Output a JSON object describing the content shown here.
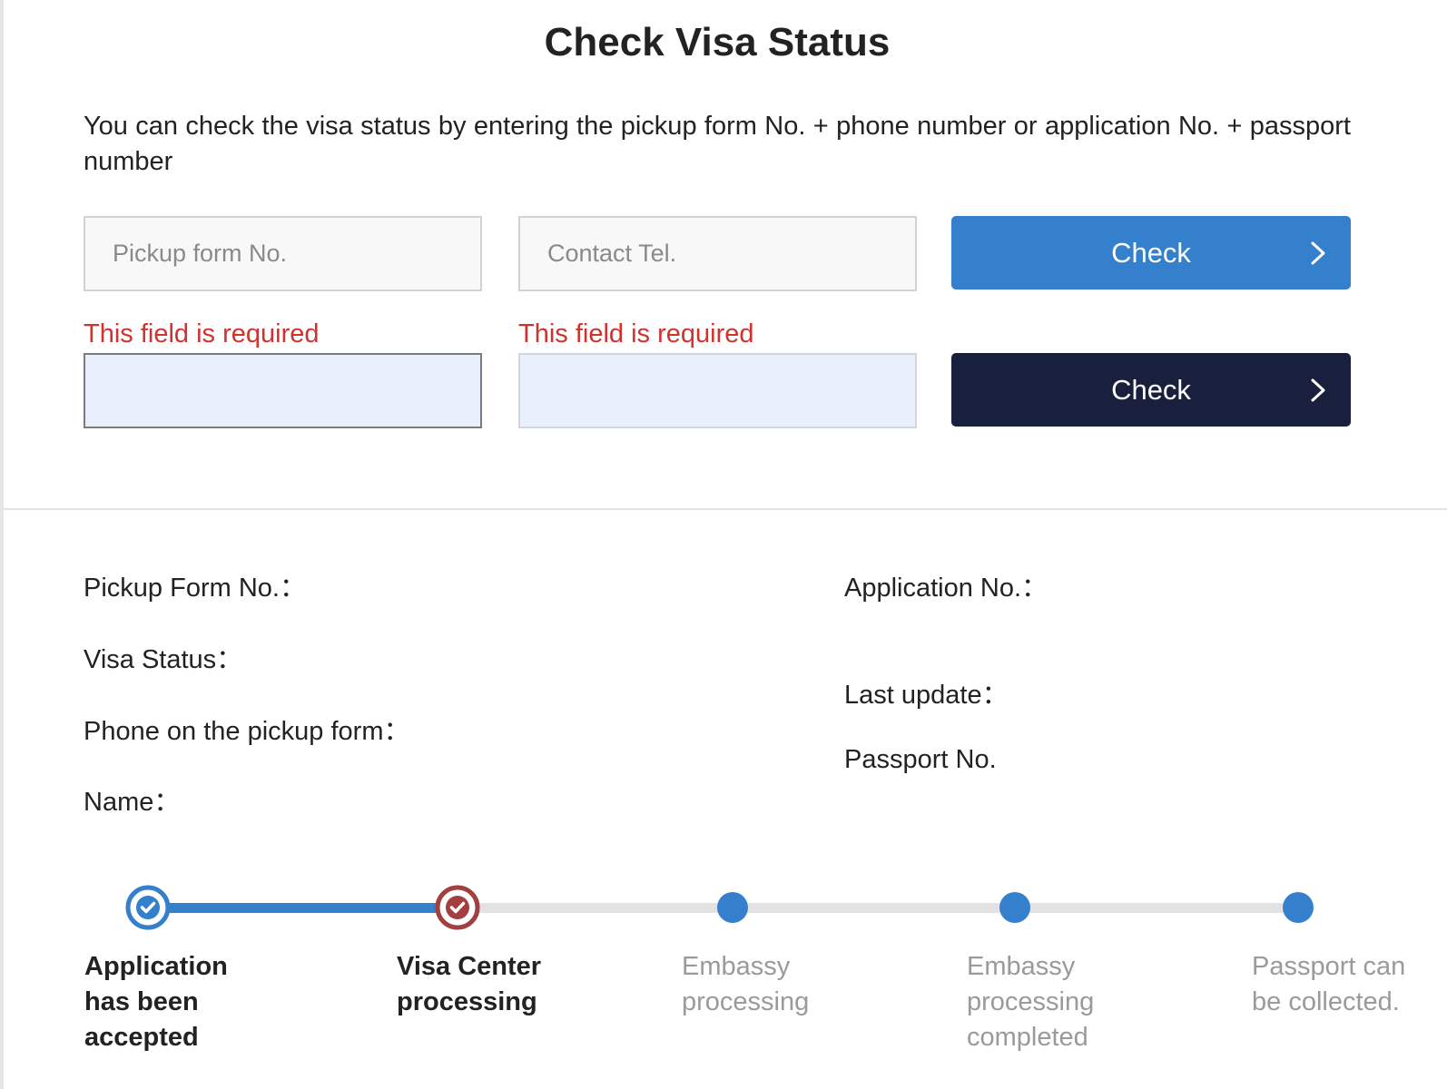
{
  "page": {
    "title": "Check Visa Status",
    "intro": "You can check the visa status by entering the pickup form No. + phone number or application No. + passport number"
  },
  "form": {
    "pickup_placeholder": "Pickup form No.",
    "tel_placeholder": "Contact Tel.",
    "check_label": "Check",
    "error_pickup": "This field is required",
    "error_tel": "This field is required",
    "check_label_2": "Check"
  },
  "details": {
    "pickup_form_no": "Pickup Form No.：",
    "visa_status": "Visa Status：",
    "phone_on_form": "Phone on the pickup form：",
    "name": "Name：",
    "application_no": "Application No.：",
    "last_update": "Last update：",
    "passport_no": "Passport No."
  },
  "progress": {
    "steps": [
      {
        "line1": "Application",
        "line2": "has been",
        "line3": "accepted",
        "state": "done"
      },
      {
        "line1": "Visa Center",
        "line2": "processing",
        "line3": "",
        "state": "current"
      },
      {
        "line1": "Embassy",
        "line2": "processing",
        "line3": "",
        "state": "pending"
      },
      {
        "line1": "Embassy",
        "line2": "processing",
        "line3": "completed",
        "state": "pending"
      },
      {
        "line1": "Passport can",
        "line2": "be collected.",
        "line3": "",
        "state": "pending"
      }
    ]
  },
  "colors": {
    "accent": "#3580cd",
    "navy": "#18203d",
    "error": "#d0322d",
    "current_step": "#a23f3f",
    "autofill_bg": "#e8f0fe"
  },
  "icons": {
    "button_chevron": "chevron-right-icon",
    "done_step": "check-circle-icon",
    "current_step": "check-circle-icon",
    "pending_step": "dot-icon"
  }
}
